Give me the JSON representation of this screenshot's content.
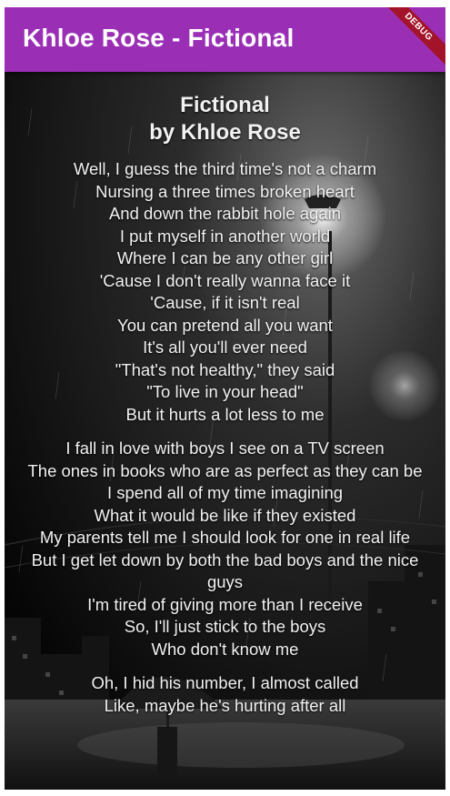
{
  "app_bar": {
    "title": "Khloe Rose - Fictional",
    "debug_label": "DEBUG",
    "color": "#9a2fb6"
  },
  "song": {
    "title": "Fictional",
    "byline": "by Khloe Rose",
    "verses": [
      [
        "Well, I guess the third time's not a charm",
        "Nursing a three times broken heart",
        "And down the rabbit hole again",
        "I put myself in another world",
        "Where I can be any other girl",
        "'Cause I don't really wanna face it",
        "'Cause, if it isn't real",
        "You can pretend all you want",
        "It's all you'll ever need",
        "\"That's not healthy,\" they said",
        "\"To live in your head\"",
        "But it hurts a lot less to me"
      ],
      [
        "I fall in love with boys I see on a TV screen",
        "The ones in books who are as perfect as they can be",
        "I spend all of my time imagining",
        "What it would be like if they existed",
        "My parents tell me I should look for one in real life",
        "But I get let down by both the bad boys and the nice guys",
        "I'm tired of giving more than I receive",
        "So, I'll just stick to the boys",
        "Who don't know me"
      ],
      [
        "Oh, I hid his number, I almost called",
        "Like, maybe he's hurting after all"
      ]
    ]
  },
  "background": {
    "description_icon": "rainy-night-street-image"
  }
}
